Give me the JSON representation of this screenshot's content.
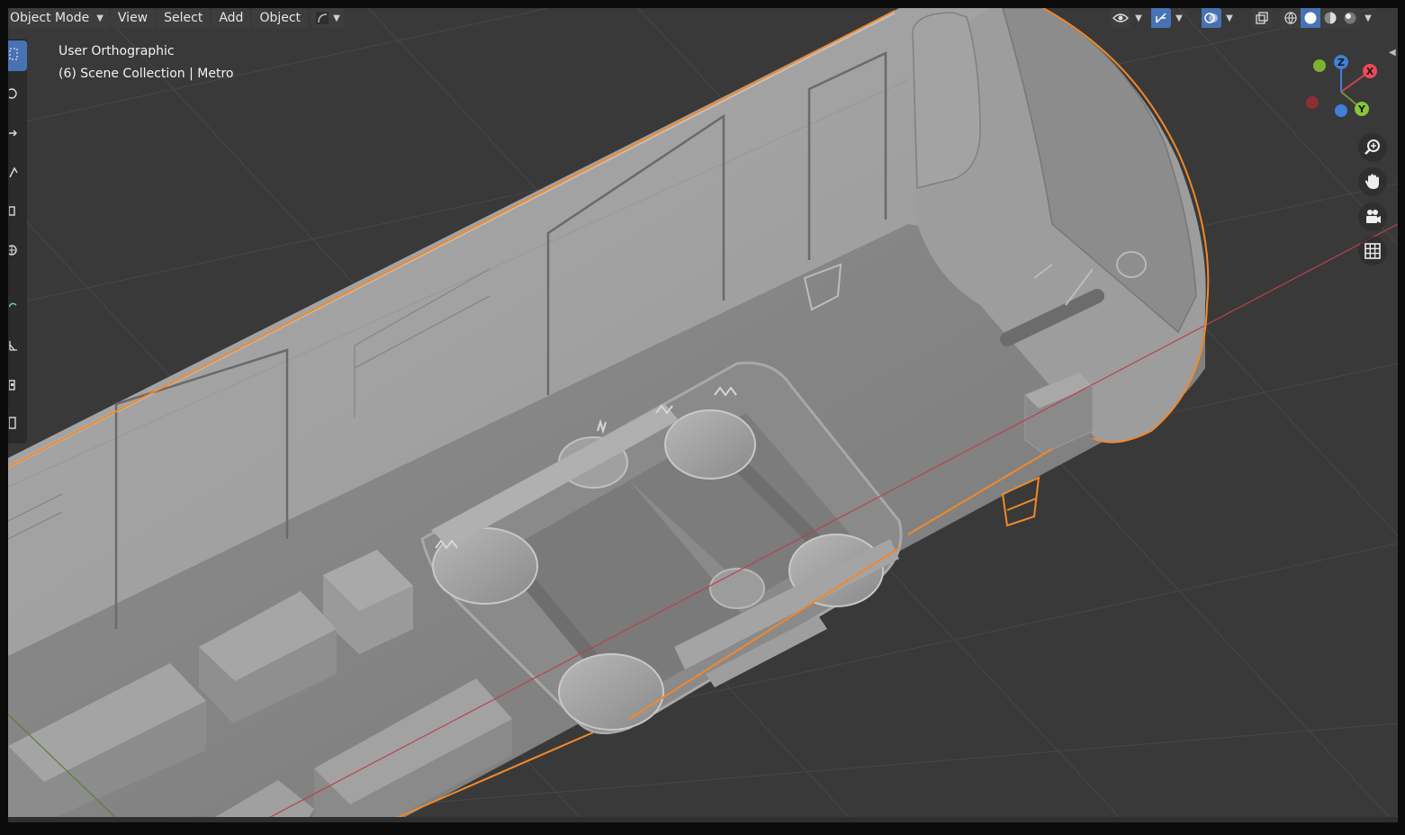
{
  "header": {
    "mode_label": "Object Mode",
    "menus": [
      "View",
      "Select",
      "Add",
      "Object"
    ]
  },
  "viewport": {
    "view_name": "User Orthographic",
    "collection_info": "(6) Scene Collection | Metro"
  },
  "gizmo": {
    "axis_x": "X",
    "axis_y": "Y",
    "axis_z": "Z"
  },
  "colors": {
    "background": "#393939",
    "grid": "#454545",
    "selection_outline": "#f0892a",
    "mesh_light": "#a9a9a9",
    "mesh_mid": "#8b8b8b",
    "mesh_dark": "#6a6a6a",
    "axis_x": "#d2434e",
    "axis_y": "#6f9631",
    "axis_z": "#3f80d8",
    "active_tool": "#4772b3"
  },
  "icons": {
    "toolbar": [
      "select-box-icon",
      "cursor-icon",
      "move-icon",
      "rotate-icon",
      "scale-icon",
      "transform-icon",
      "annotate-icon",
      "measure-icon",
      "add-cube-icon",
      "tool-settings-icon"
    ],
    "nav": [
      "zoom-icon",
      "hand-pan-icon",
      "camera-view-icon",
      "ortho-grid-icon"
    ],
    "header_right": [
      "visibility-eye-icon",
      "gizmo-icon",
      "overlay-icon",
      "xray-icon",
      "wireframe-shading-icon",
      "solid-shading-icon",
      "material-shading-icon",
      "rendered-shading-icon"
    ]
  }
}
